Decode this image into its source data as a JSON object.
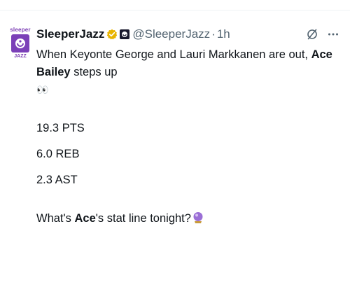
{
  "tweet": {
    "display_name": "SleeperJazz",
    "handle": "@SleeperJazz",
    "separator": "·",
    "time": "1h",
    "avatar": {
      "top_text": "sleeper",
      "bottom_text": "JAZZ",
      "color": "#7b3fb8"
    },
    "verified_color": "#e8b400",
    "icons": {
      "verified": "verified-badge-icon",
      "affiliate": "affiliate-badge-icon",
      "grok": "grok-icon",
      "more": "more-icon",
      "eyes": "eyes-emoji",
      "crystal_ball": "crystal-ball-emoji"
    },
    "line1_pre": "When Keyonte George and Lauri Markkanen are out, ",
    "line1_bold": "Ace Bailey",
    "line1_post": " steps up",
    "eyes": "👀",
    "stats": [
      "19.3 PTS",
      "6.0 REB",
      "2.3 AST"
    ],
    "question_pre": "What's ",
    "question_bold": "Ace",
    "question_post": "'s stat line tonight?"
  }
}
